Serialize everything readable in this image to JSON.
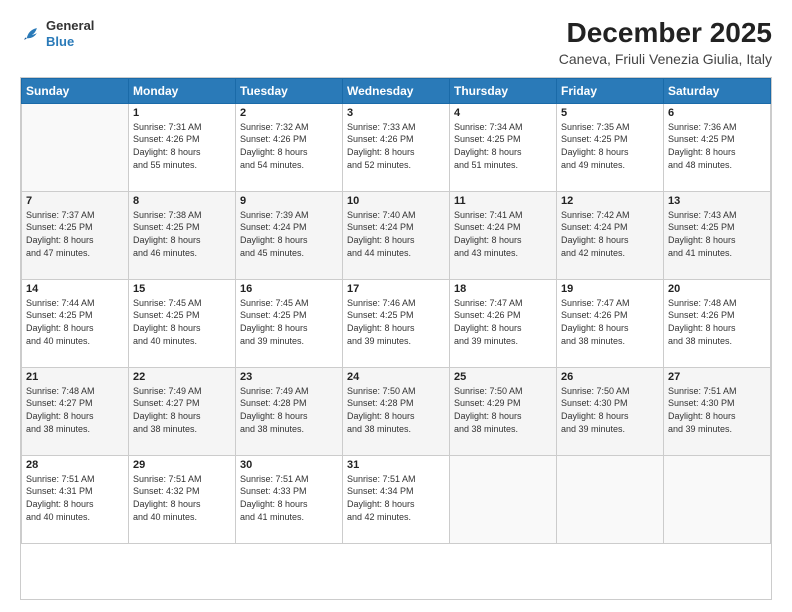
{
  "header": {
    "logo": {
      "general": "General",
      "blue": "Blue"
    },
    "title": "December 2025",
    "subtitle": "Caneva, Friuli Venezia Giulia, Italy"
  },
  "calendar": {
    "days_of_week": [
      "Sunday",
      "Monday",
      "Tuesday",
      "Wednesday",
      "Thursday",
      "Friday",
      "Saturday"
    ],
    "weeks": [
      [
        {
          "day": "",
          "info": ""
        },
        {
          "day": "1",
          "info": "Sunrise: 7:31 AM\nSunset: 4:26 PM\nDaylight: 8 hours\nand 55 minutes."
        },
        {
          "day": "2",
          "info": "Sunrise: 7:32 AM\nSunset: 4:26 PM\nDaylight: 8 hours\nand 54 minutes."
        },
        {
          "day": "3",
          "info": "Sunrise: 7:33 AM\nSunset: 4:26 PM\nDaylight: 8 hours\nand 52 minutes."
        },
        {
          "day": "4",
          "info": "Sunrise: 7:34 AM\nSunset: 4:25 PM\nDaylight: 8 hours\nand 51 minutes."
        },
        {
          "day": "5",
          "info": "Sunrise: 7:35 AM\nSunset: 4:25 PM\nDaylight: 8 hours\nand 49 minutes."
        },
        {
          "day": "6",
          "info": "Sunrise: 7:36 AM\nSunset: 4:25 PM\nDaylight: 8 hours\nand 48 minutes."
        }
      ],
      [
        {
          "day": "7",
          "info": "Sunrise: 7:37 AM\nSunset: 4:25 PM\nDaylight: 8 hours\nand 47 minutes."
        },
        {
          "day": "8",
          "info": "Sunrise: 7:38 AM\nSunset: 4:25 PM\nDaylight: 8 hours\nand 46 minutes."
        },
        {
          "day": "9",
          "info": "Sunrise: 7:39 AM\nSunset: 4:24 PM\nDaylight: 8 hours\nand 45 minutes."
        },
        {
          "day": "10",
          "info": "Sunrise: 7:40 AM\nSunset: 4:24 PM\nDaylight: 8 hours\nand 44 minutes."
        },
        {
          "day": "11",
          "info": "Sunrise: 7:41 AM\nSunset: 4:24 PM\nDaylight: 8 hours\nand 43 minutes."
        },
        {
          "day": "12",
          "info": "Sunrise: 7:42 AM\nSunset: 4:24 PM\nDaylight: 8 hours\nand 42 minutes."
        },
        {
          "day": "13",
          "info": "Sunrise: 7:43 AM\nSunset: 4:25 PM\nDaylight: 8 hours\nand 41 minutes."
        }
      ],
      [
        {
          "day": "14",
          "info": "Sunrise: 7:44 AM\nSunset: 4:25 PM\nDaylight: 8 hours\nand 40 minutes."
        },
        {
          "day": "15",
          "info": "Sunrise: 7:45 AM\nSunset: 4:25 PM\nDaylight: 8 hours\nand 40 minutes."
        },
        {
          "day": "16",
          "info": "Sunrise: 7:45 AM\nSunset: 4:25 PM\nDaylight: 8 hours\nand 39 minutes."
        },
        {
          "day": "17",
          "info": "Sunrise: 7:46 AM\nSunset: 4:25 PM\nDaylight: 8 hours\nand 39 minutes."
        },
        {
          "day": "18",
          "info": "Sunrise: 7:47 AM\nSunset: 4:26 PM\nDaylight: 8 hours\nand 39 minutes."
        },
        {
          "day": "19",
          "info": "Sunrise: 7:47 AM\nSunset: 4:26 PM\nDaylight: 8 hours\nand 38 minutes."
        },
        {
          "day": "20",
          "info": "Sunrise: 7:48 AM\nSunset: 4:26 PM\nDaylight: 8 hours\nand 38 minutes."
        }
      ],
      [
        {
          "day": "21",
          "info": "Sunrise: 7:48 AM\nSunset: 4:27 PM\nDaylight: 8 hours\nand 38 minutes."
        },
        {
          "day": "22",
          "info": "Sunrise: 7:49 AM\nSunset: 4:27 PM\nDaylight: 8 hours\nand 38 minutes."
        },
        {
          "day": "23",
          "info": "Sunrise: 7:49 AM\nSunset: 4:28 PM\nDaylight: 8 hours\nand 38 minutes."
        },
        {
          "day": "24",
          "info": "Sunrise: 7:50 AM\nSunset: 4:28 PM\nDaylight: 8 hours\nand 38 minutes."
        },
        {
          "day": "25",
          "info": "Sunrise: 7:50 AM\nSunset: 4:29 PM\nDaylight: 8 hours\nand 38 minutes."
        },
        {
          "day": "26",
          "info": "Sunrise: 7:50 AM\nSunset: 4:30 PM\nDaylight: 8 hours\nand 39 minutes."
        },
        {
          "day": "27",
          "info": "Sunrise: 7:51 AM\nSunset: 4:30 PM\nDaylight: 8 hours\nand 39 minutes."
        }
      ],
      [
        {
          "day": "28",
          "info": "Sunrise: 7:51 AM\nSunset: 4:31 PM\nDaylight: 8 hours\nand 40 minutes."
        },
        {
          "day": "29",
          "info": "Sunrise: 7:51 AM\nSunset: 4:32 PM\nDaylight: 8 hours\nand 40 minutes."
        },
        {
          "day": "30",
          "info": "Sunrise: 7:51 AM\nSunset: 4:33 PM\nDaylight: 8 hours\nand 41 minutes."
        },
        {
          "day": "31",
          "info": "Sunrise: 7:51 AM\nSunset: 4:34 PM\nDaylight: 8 hours\nand 42 minutes."
        },
        {
          "day": "",
          "info": ""
        },
        {
          "day": "",
          "info": ""
        },
        {
          "day": "",
          "info": ""
        }
      ]
    ]
  }
}
